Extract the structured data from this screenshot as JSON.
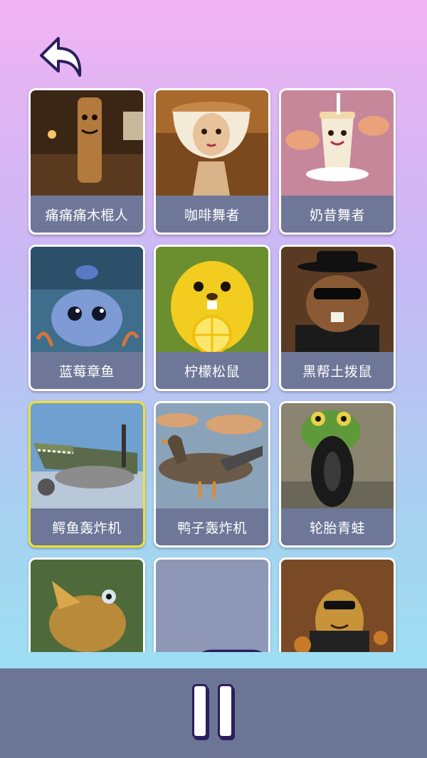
{
  "navigation": {
    "back_icon": "back-arrow-icon"
  },
  "cards": [
    {
      "label": "痛痛痛木棍人",
      "selected": false,
      "locked": false
    },
    {
      "label": "咖啡舞者",
      "selected": false,
      "locked": false
    },
    {
      "label": "奶昔舞者",
      "selected": false,
      "locked": false
    },
    {
      "label": "蓝莓章鱼",
      "selected": false,
      "locked": false
    },
    {
      "label": "柠檬松鼠",
      "selected": false,
      "locked": false
    },
    {
      "label": "黑帮土拨鼠",
      "selected": false,
      "locked": false
    },
    {
      "label": "鳄鱼轰炸机",
      "selected": true,
      "locked": false
    },
    {
      "label": "鸭子轰炸机",
      "selected": false,
      "locked": false
    },
    {
      "label": "轮胎青蛙",
      "selected": false,
      "locked": false
    },
    {
      "label": "",
      "selected": false,
      "locked": false
    },
    {
      "label": "",
      "selected": false,
      "locked": true,
      "icon": "video-camera-icon"
    },
    {
      "label": "",
      "selected": false,
      "locked": false
    }
  ],
  "controls": {
    "pause_icon": "pause-icon"
  },
  "colors": {
    "label_bg": "#6e7797",
    "selected_border": "#f3e12a",
    "bottom_bar": "#6c7596"
  }
}
